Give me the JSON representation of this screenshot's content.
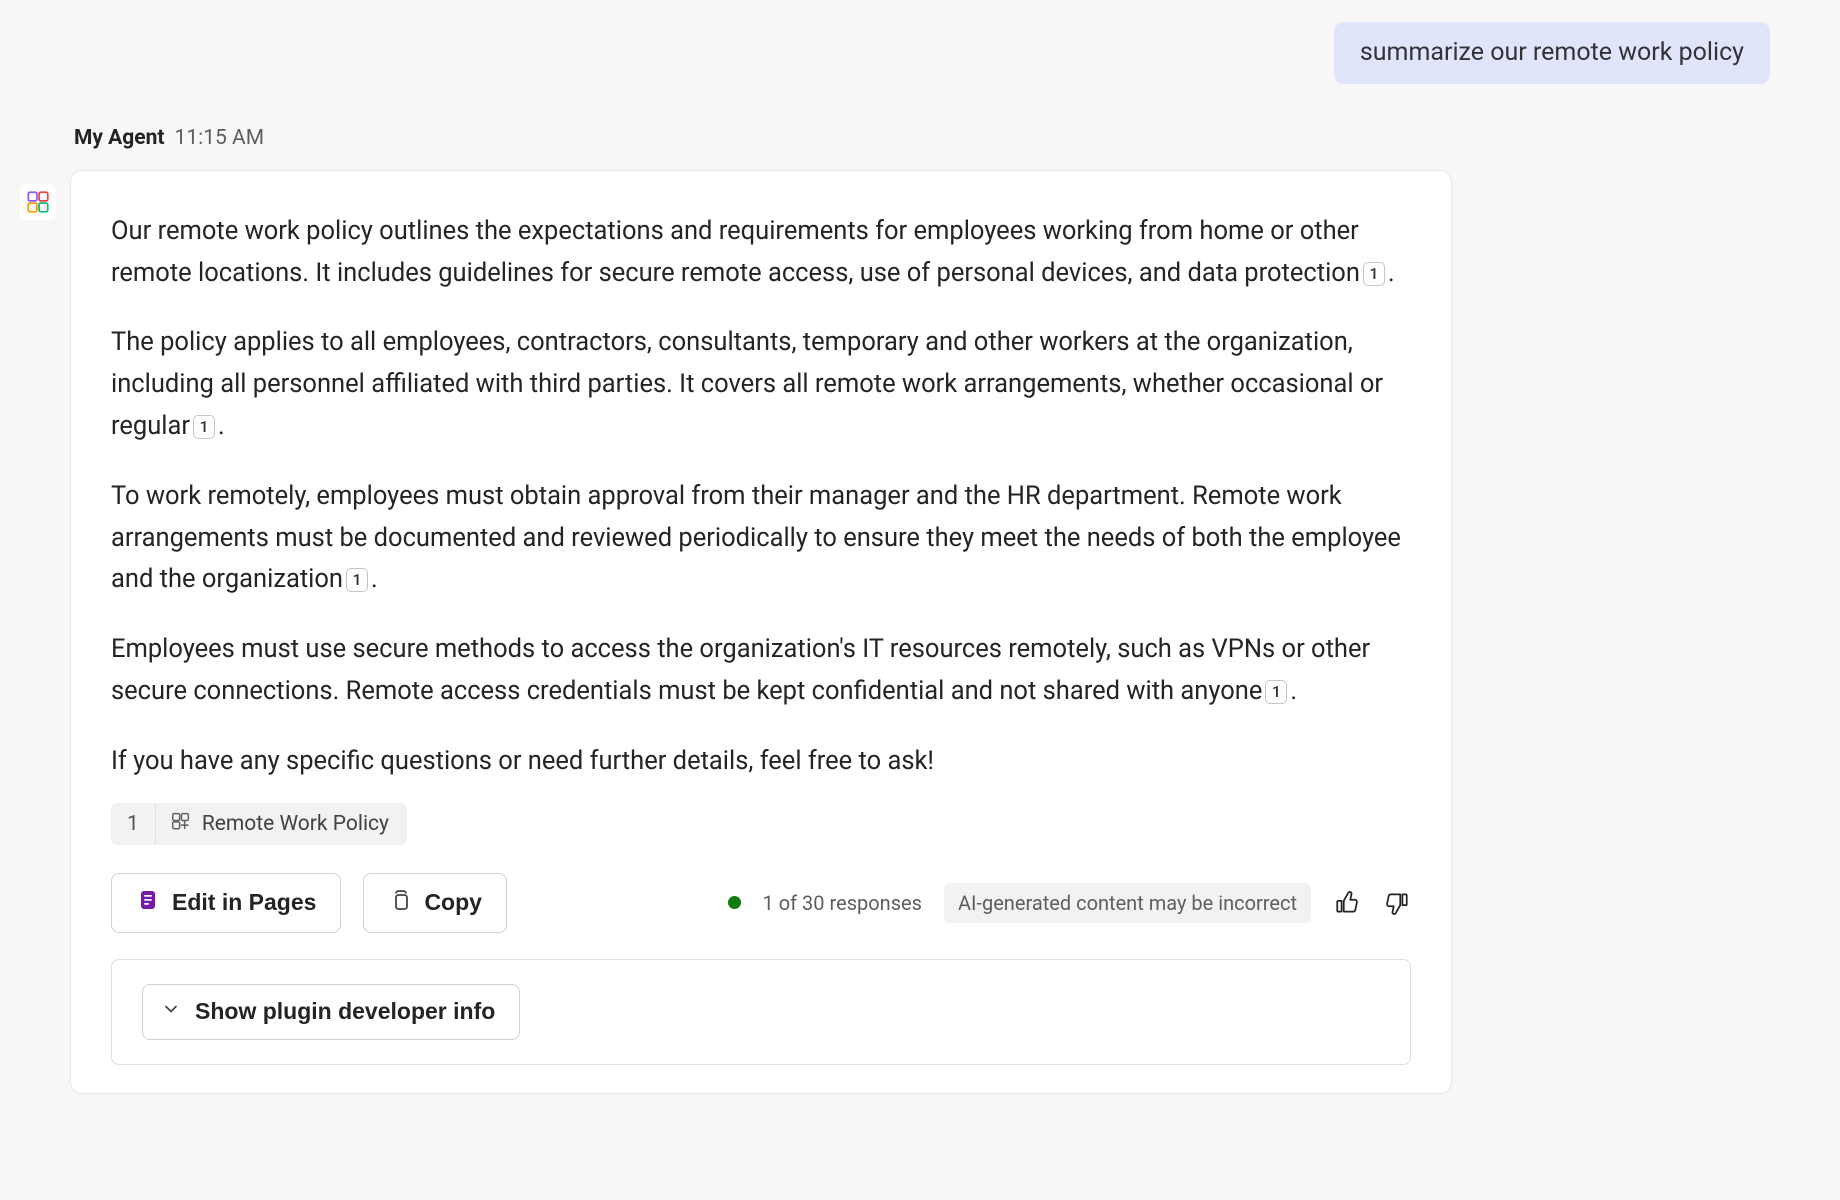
{
  "user_message": "summarize our remote work policy",
  "agent": {
    "name": "My Agent",
    "time": "11:15 AM"
  },
  "paragraphs": [
    {
      "text": "Our remote work policy outlines the expectations and requirements for employees working from home or other remote locations. It includes guidelines for secure remote access, use of personal devices, and data protection",
      "citation": "1",
      "trailing": "."
    },
    {
      "text": "The policy applies to all employees, contractors, consultants, temporary and other workers at the organization, including all personnel affiliated with third parties. It covers all remote work arrangements, whether occasional or regular",
      "citation": "1",
      "trailing": "."
    },
    {
      "text": "To work remotely, employees must obtain approval from their manager and the HR department. Remote work arrangements must be documented and reviewed periodically to ensure they meet the needs of both the employee and the organization",
      "citation": "1",
      "trailing": "."
    },
    {
      "text": "Employees must use secure methods to access the organization's IT resources remotely, such as VPNs or other secure connections. Remote access credentials must be kept confidential and not shared with anyone",
      "citation": "1",
      "trailing": "."
    },
    {
      "text": "If you have any specific questions or need further details, feel free to ask!",
      "citation": null,
      "trailing": ""
    }
  ],
  "reference": {
    "index": "1",
    "title": "Remote Work Policy"
  },
  "actions": {
    "edit_label": "Edit in Pages",
    "copy_label": "Copy"
  },
  "status": {
    "responses": "1 of 30 responses",
    "ai_notice": "AI-generated content may be incorrect"
  },
  "dev_toggle_label": "Show plugin developer info"
}
